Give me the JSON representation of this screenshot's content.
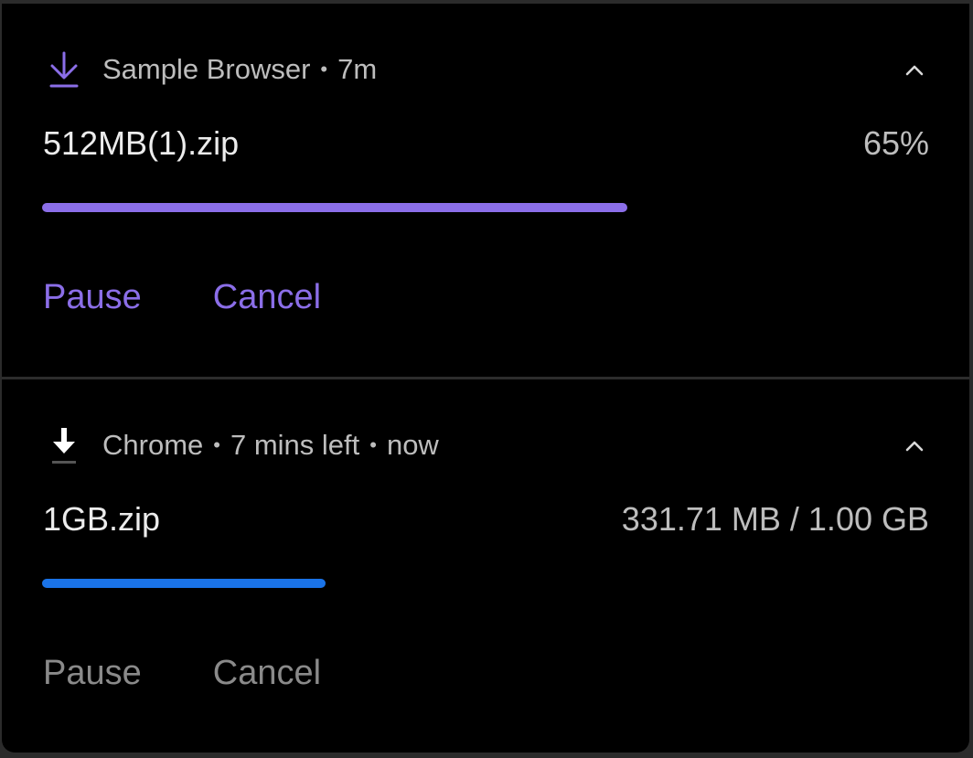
{
  "colors": {
    "accent_purple": "#8b6ee8",
    "accent_blue": "#1a73e8",
    "background": "#000000",
    "muted_text": "#bdbdbd",
    "disabled_action": "#8a8a8a"
  },
  "notifications": [
    {
      "app": "Sample Browser",
      "separator": "•",
      "time": "7m",
      "filename": "512MB(1).zip",
      "progress_label": "65%",
      "progress_value": 0.66,
      "icon": "download-arrow-icon",
      "expand_icon": "chevron-up-icon",
      "actions": {
        "pause": "Pause",
        "cancel": "Cancel"
      }
    },
    {
      "app": "Chrome",
      "separator": "•",
      "eta": "7 mins left",
      "time": "now",
      "filename": "1GB.zip",
      "progress_label": "331.71 MB / 1.00 GB",
      "progress_value": 0.32,
      "icon": "download-icon",
      "expand_icon": "chevron-up-icon",
      "actions": {
        "pause": "Pause",
        "cancel": "Cancel"
      }
    }
  ]
}
